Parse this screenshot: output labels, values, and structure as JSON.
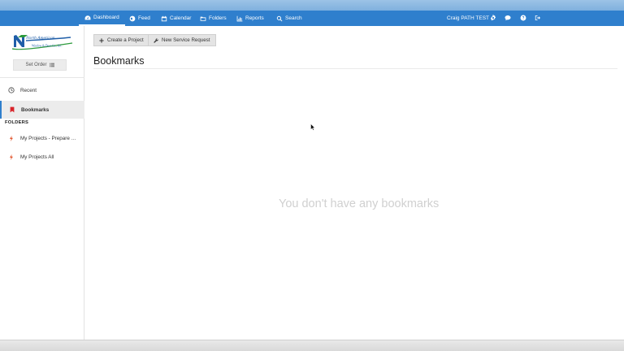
{
  "nav": {
    "items": [
      {
        "label": "Dashboard",
        "icon": "dashboard-icon"
      },
      {
        "label": "Feed",
        "icon": "globe-icon"
      },
      {
        "label": "Calendar",
        "icon": "calendar-icon"
      },
      {
        "label": "Folders",
        "icon": "folder-icon"
      },
      {
        "label": "Reports",
        "icon": "bar-chart-icon"
      },
      {
        "label": "Search",
        "icon": "search-icon"
      }
    ],
    "user_name": "Craig PATH TEST",
    "right_icons": [
      "gear-icon",
      "chat-icon",
      "help-icon",
      "logout-icon"
    ],
    "accent_color": "#2f7fcd"
  },
  "sidebar": {
    "set_order_label": "Set Order",
    "items": [
      {
        "label": "Recent",
        "icon": "clock-icon"
      },
      {
        "label": "Bookmarks",
        "icon": "bookmark-icon"
      }
    ],
    "folders_heading": "FOLDERS",
    "folders": [
      {
        "label": "My Projects - Prepare Orders",
        "icon": "lightning-icon"
      },
      {
        "label": "My Projects All",
        "icon": "lightning-icon"
      }
    ]
  },
  "main": {
    "create_project_label": "Create a Project",
    "new_service_request_label": "New Service Request",
    "title": "Bookmarks",
    "empty_message": "You don't have any bookmarks"
  }
}
